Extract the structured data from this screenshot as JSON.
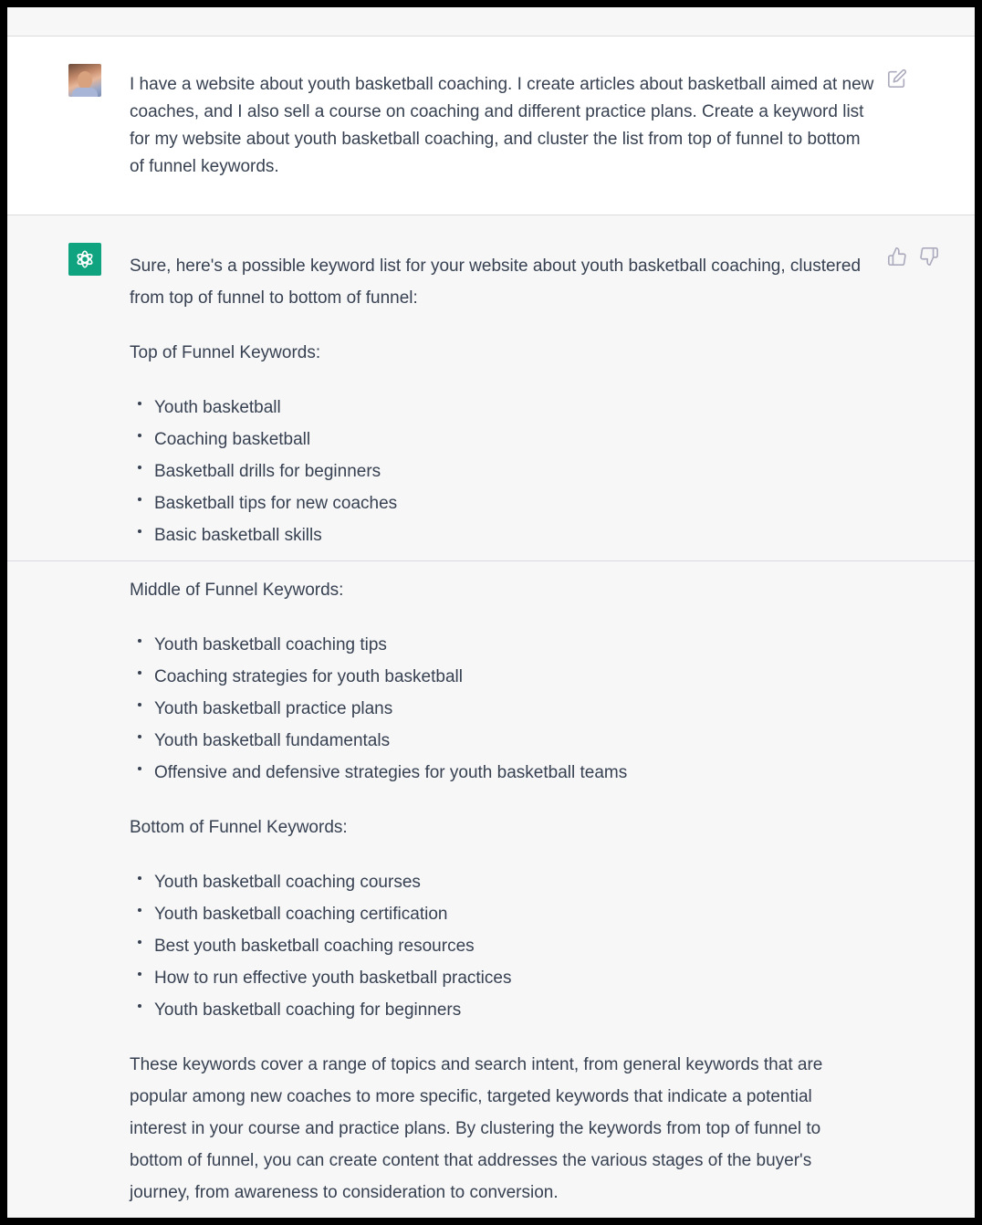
{
  "user_message": {
    "text": "I have a website about youth basketball coaching. I create articles about basketball aimed at new coaches, and I also sell a course on coaching and different practice plans. Create a keyword list for my website about youth basketball coaching, and cluster the list from top of funnel to bottom of funnel keywords.",
    "avatar": "user-photo",
    "action_icon": "edit-icon"
  },
  "assistant_message": {
    "avatar": "openai-logo",
    "accent_color": "#10a37f",
    "intro": "Sure, here's a possible keyword list for your website about youth basketball coaching, clustered from top of funnel to bottom of funnel:",
    "sections": [
      {
        "heading": "Top of Funnel Keywords:",
        "items": [
          "Youth basketball",
          "Coaching basketball",
          "Basketball drills for beginners",
          "Basketball tips for new coaches",
          "Basic basketball skills"
        ]
      },
      {
        "heading": "Middle of Funnel Keywords:",
        "items": [
          "Youth basketball coaching tips",
          "Coaching strategies for youth basketball",
          "Youth basketball practice plans",
          "Youth basketball fundamentals",
          "Offensive and defensive strategies for youth basketball teams"
        ]
      },
      {
        "heading": "Bottom of Funnel Keywords:",
        "items": [
          "Youth basketball coaching courses",
          "Youth basketball coaching certification",
          "Best youth basketball coaching resources",
          "How to run effective youth basketball practices",
          "Youth basketball coaching for beginners"
        ]
      }
    ],
    "conclusion": "These keywords cover a range of topics and search intent, from general keywords that are popular among new coaches to more specific, targeted keywords that indicate a potential interest in your course and practice plans. By clustering the keywords from top of funnel to bottom of funnel, you can create content that addresses the various stages of the buyer's journey, from awareness to consideration to conversion.",
    "feedback_icons": [
      "thumbs-up-icon",
      "thumbs-down-icon"
    ]
  }
}
